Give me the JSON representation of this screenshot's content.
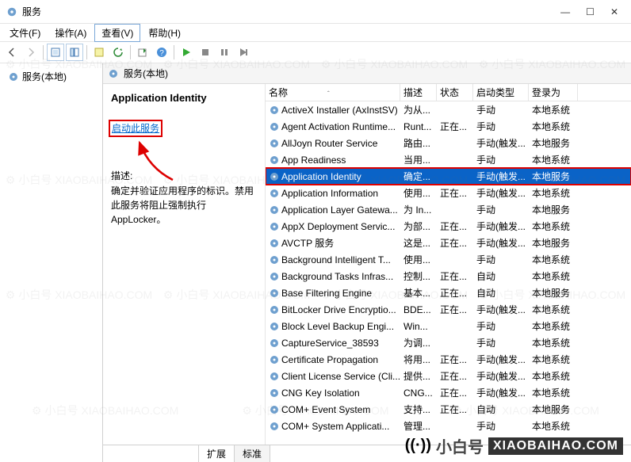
{
  "window": {
    "title": "服务"
  },
  "menu": {
    "file": "文件(F)",
    "action": "操作(A)",
    "view": "查看(V)",
    "help": "帮助(H)"
  },
  "left": {
    "header": "服务(本地)"
  },
  "padheader": "服务(本地)",
  "detail": {
    "title": "Application Identity",
    "start_link": "启动此服务",
    "desc_label": "描述:",
    "desc": "确定并验证应用程序的标识。禁用此服务将阻止强制执行 AppLocker。"
  },
  "columns": {
    "name": "名称",
    "desc": "描述",
    "status": "状态",
    "startup": "启动类型",
    "logon": "登录为"
  },
  "tabs": {
    "ext": "扩展",
    "std": "标准"
  },
  "services": [
    {
      "name": "ActiveX Installer (AxInstSV)",
      "desc": "为从...",
      "status": "",
      "startup": "手动",
      "logon": "本地系统"
    },
    {
      "name": "Agent Activation Runtime...",
      "desc": "Runt...",
      "status": "正在...",
      "startup": "手动",
      "logon": "本地系统"
    },
    {
      "name": "AllJoyn Router Service",
      "desc": "路由...",
      "status": "",
      "startup": "手动(触发...",
      "logon": "本地服务"
    },
    {
      "name": "App Readiness",
      "desc": "当用...",
      "status": "",
      "startup": "手动",
      "logon": "本地系统"
    },
    {
      "name": "Application Identity",
      "desc": "确定...",
      "status": "",
      "startup": "手动(触发...",
      "logon": "本地服务",
      "selected": true
    },
    {
      "name": "Application Information",
      "desc": "使用...",
      "status": "正在...",
      "startup": "手动(触发...",
      "logon": "本地系统"
    },
    {
      "name": "Application Layer Gatewa...",
      "desc": "为 In...",
      "status": "",
      "startup": "手动",
      "logon": "本地服务"
    },
    {
      "name": "AppX Deployment Servic...",
      "desc": "为部...",
      "status": "正在...",
      "startup": "手动(触发...",
      "logon": "本地系统"
    },
    {
      "name": "AVCTP 服务",
      "desc": "这是...",
      "status": "正在...",
      "startup": "手动(触发...",
      "logon": "本地服务"
    },
    {
      "name": "Background Intelligent T...",
      "desc": "使用...",
      "status": "",
      "startup": "手动",
      "logon": "本地系统"
    },
    {
      "name": "Background Tasks Infras...",
      "desc": "控制...",
      "status": "正在...",
      "startup": "自动",
      "logon": "本地系统"
    },
    {
      "name": "Base Filtering Engine",
      "desc": "基本...",
      "status": "正在...",
      "startup": "自动",
      "logon": "本地服务"
    },
    {
      "name": "BitLocker Drive Encryptio...",
      "desc": "BDE...",
      "status": "正在...",
      "startup": "手动(触发...",
      "logon": "本地系统"
    },
    {
      "name": "Block Level Backup Engi...",
      "desc": "Win...",
      "status": "",
      "startup": "手动",
      "logon": "本地系统"
    },
    {
      "name": "CaptureService_38593",
      "desc": "为调...",
      "status": "",
      "startup": "手动",
      "logon": "本地系统"
    },
    {
      "name": "Certificate Propagation",
      "desc": "将用...",
      "status": "正在...",
      "startup": "手动(触发...",
      "logon": "本地系统"
    },
    {
      "name": "Client License Service (Cli...",
      "desc": "提供...",
      "status": "正在...",
      "startup": "手动(触发...",
      "logon": "本地系统"
    },
    {
      "name": "CNG Key Isolation",
      "desc": "CNG...",
      "status": "正在...",
      "startup": "手动(触发...",
      "logon": "本地系统"
    },
    {
      "name": "COM+ Event System",
      "desc": "支持...",
      "status": "正在...",
      "startup": "自动",
      "logon": "本地服务"
    },
    {
      "name": "COM+ System Applicati...",
      "desc": "管理...",
      "status": "",
      "startup": "手动",
      "logon": "本地系统"
    }
  ],
  "brand": {
    "cn": "小白号",
    "en": "XIAOBAIHAO.COM"
  },
  "wm": "⚙ 小白号   XIAOBAIHAO.COM"
}
